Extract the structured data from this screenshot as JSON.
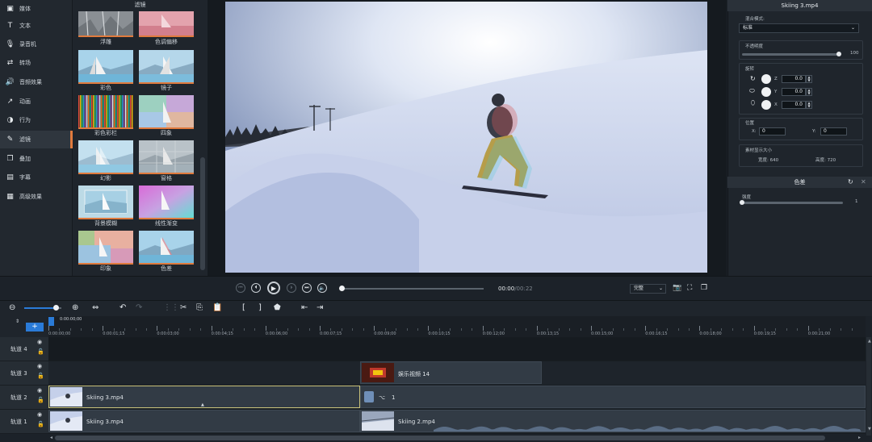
{
  "nav": {
    "items": [
      {
        "label": "媒体",
        "icon": "media-icon"
      },
      {
        "label": "文本",
        "icon": "text-icon"
      },
      {
        "label": "录音机",
        "icon": "microphone-icon"
      },
      {
        "label": "转场",
        "icon": "transition-icon"
      },
      {
        "label": "音频效果",
        "icon": "audio-effect-icon"
      },
      {
        "label": "动画",
        "icon": "animation-icon"
      },
      {
        "label": "行为",
        "icon": "behavior-icon"
      },
      {
        "label": "滤镜",
        "icon": "filter-icon",
        "active": true
      },
      {
        "label": "叠加",
        "icon": "overlay-icon"
      },
      {
        "label": "字幕",
        "icon": "caption-icon"
      },
      {
        "label": "高级效果",
        "icon": "advanced-effect-icon"
      }
    ]
  },
  "filters": {
    "title": "滤镜",
    "items": [
      "浮雕",
      "色调偏移",
      "彩色",
      "镜子",
      "彩色彩栏",
      "四象",
      "幻影",
      "窗格",
      "背景模糊",
      "线性渐变",
      "印象",
      "色差"
    ]
  },
  "right": {
    "clip_title": "Skiing 3.mp4",
    "blend_label": "混合模式:",
    "blend_value": "标准",
    "opacity_label": "不透明度",
    "opacity_value": "100",
    "rotate_label": "旋转",
    "rot_z": "Z",
    "rot_z_val": "0.0",
    "rot_y": "Y",
    "rot_y_val": "0.0",
    "rot_x": "X",
    "rot_x_val": "0.0",
    "position_label": "位置",
    "pos_x_label": "X:",
    "pos_x": "0",
    "pos_y_label": "Y:",
    "pos_y": "0",
    "size_label": "素材显示大小",
    "width_text": "宽度:   640",
    "height_text": "高度:   720",
    "effect_title": "色差",
    "strength_label": "强度",
    "strength_value": "1",
    "opacity_level": 1.0,
    "strength_level": 0.0
  },
  "transport": {
    "time_current": "00:00",
    "time_sep": "/",
    "time_total": "00:22",
    "quality": "完整",
    "progress": 0.0
  },
  "timeline": {
    "zoom_level": 0.85,
    "ruler": [
      "0:00:00;00",
      "0:00:01;15",
      "0:00:03;00",
      "0:00:04;15",
      "0:00:06;00",
      "0:00:07;15",
      "0:00:09;00",
      "0:00:10;15",
      "0:00:12;00",
      "0:00:13;15",
      "0:00:15;00",
      "0:00:16;15",
      "0:00:18;00",
      "0:00:19;15",
      "0:00:21;00"
    ],
    "playhead_label": "0:00:00;00",
    "tracks": [
      {
        "name": "轨道 4"
      },
      {
        "name": "轨道 3"
      },
      {
        "name": "轨道 2"
      },
      {
        "name": "轨道 1"
      }
    ],
    "clips": {
      "t3_music": "娱乐视频 14",
      "t2_skiing": "Skiing 3.mp4",
      "t2_group": "1",
      "t1_skiing3": "Skiing 3.mp4",
      "t1_skiing2": "Skiing 2.mp4"
    }
  },
  "colors": {
    "accent": "#e07a3d",
    "blue": "#2a7bd8",
    "selected_clip_border": "#c9c27a"
  }
}
